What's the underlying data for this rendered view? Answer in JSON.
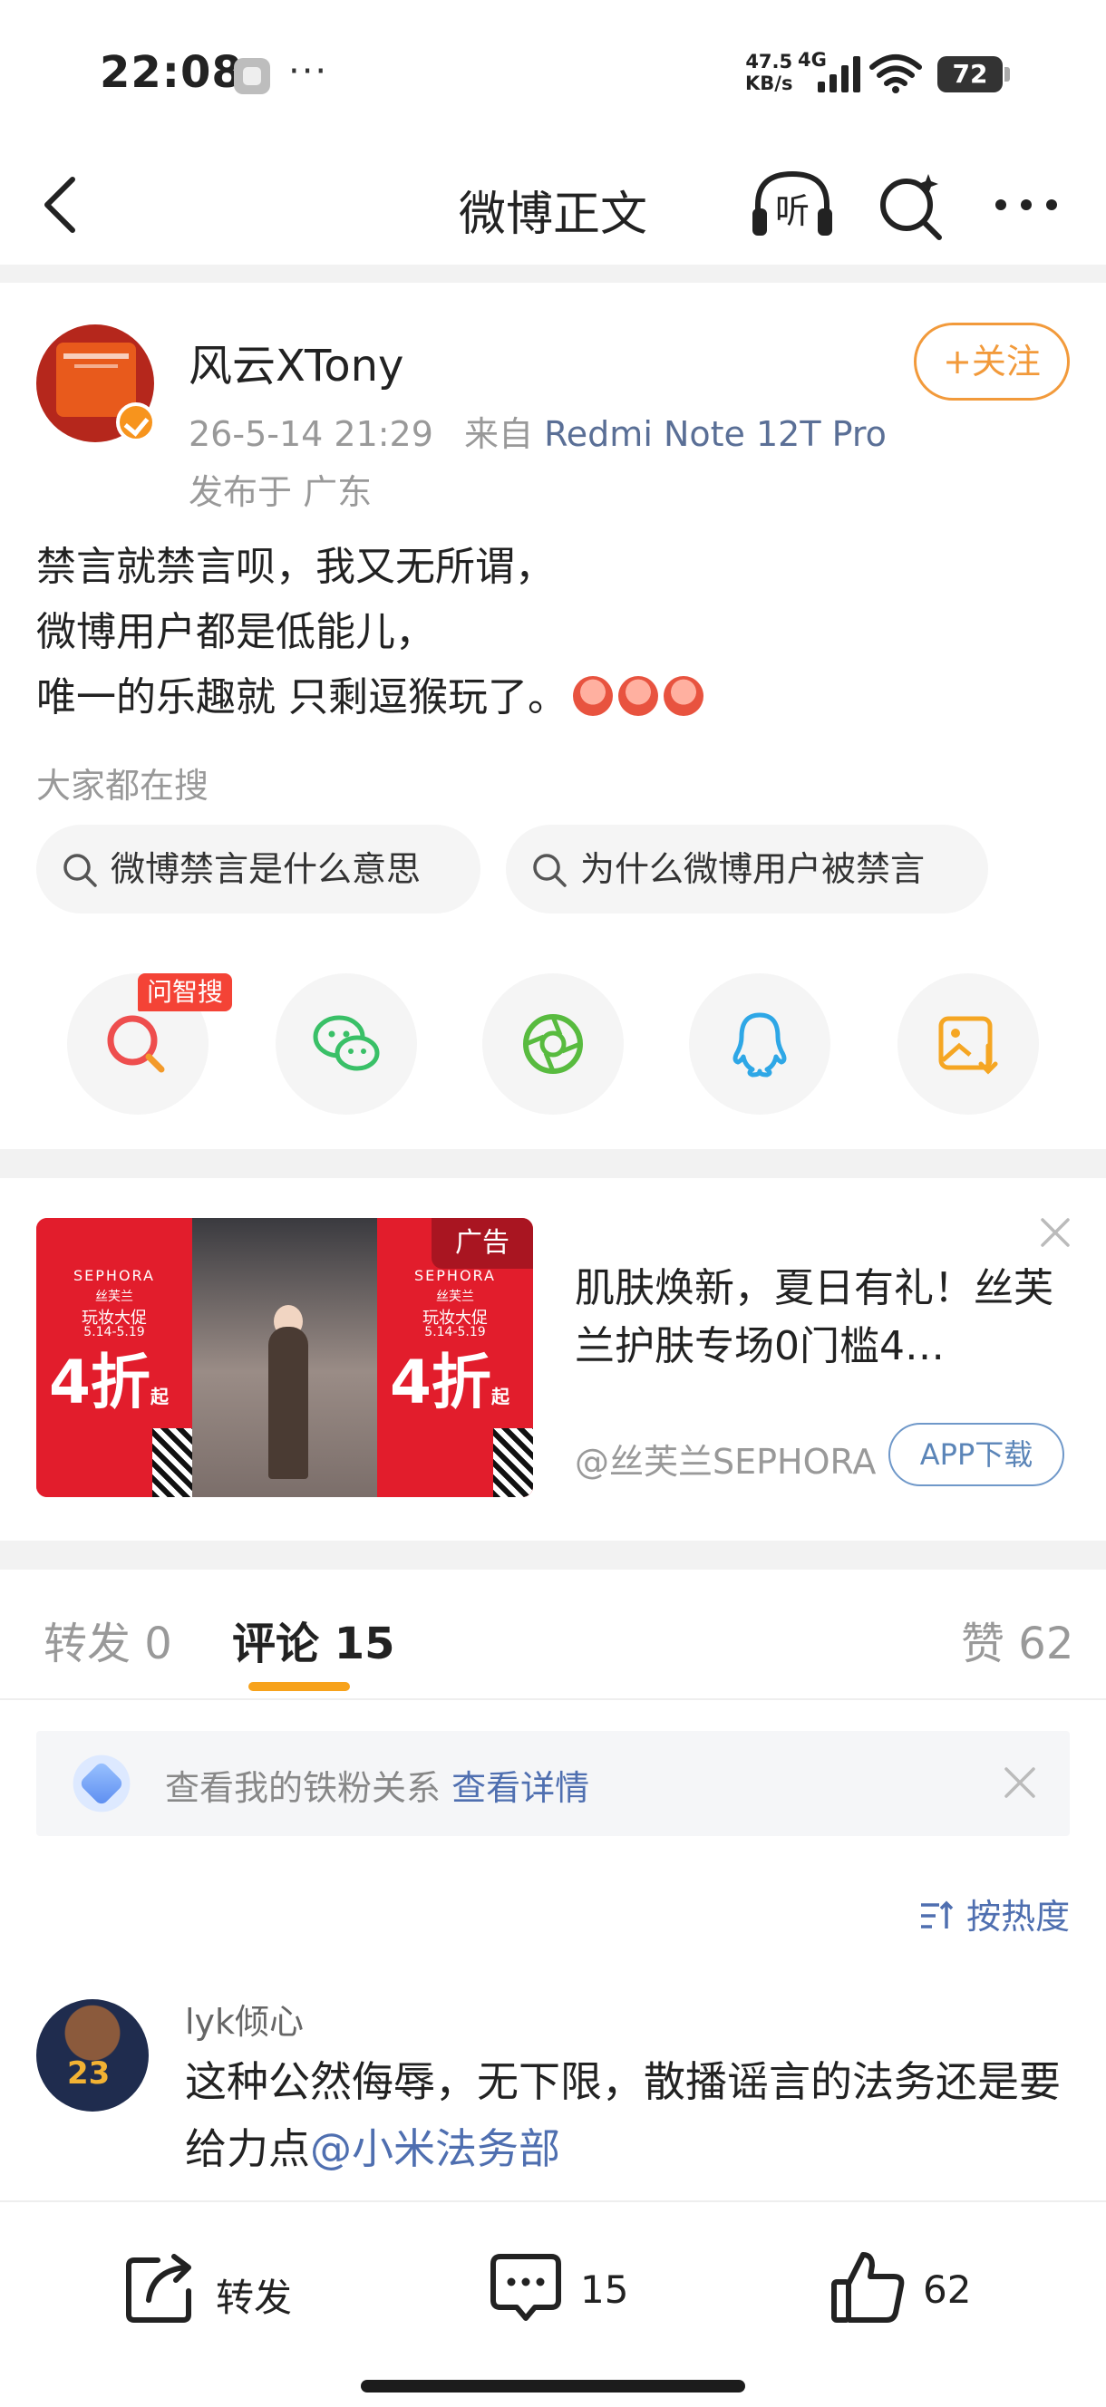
{
  "status_bar": {
    "time": "22:08",
    "more": "···",
    "speed_value": "47.5",
    "speed_unit": "KB/s",
    "network": "4G",
    "battery": "72",
    "icons": [
      "app-icon",
      "signal-icon",
      "wifi-icon",
      "battery-icon"
    ]
  },
  "nav": {
    "title": "微博正文",
    "listen_label": "听",
    "icons": [
      "back-icon",
      "listen-icon",
      "search-icon",
      "more-icon"
    ]
  },
  "post": {
    "author": "风云XTony",
    "timestamp": "26-5-14 21:29",
    "source_prefix": "来自",
    "source": "Redmi Note 12T Pro",
    "location": "发布于 广东",
    "follow_label": "+关注",
    "lines": [
      "禁言就禁言呗，我又无所谓，",
      "微博用户都是低能儿，",
      "唯一的乐趣就 只剩逗猴玩了。"
    ],
    "emoji": [
      "laugh-emoji",
      "laugh-emoji",
      "laugh-emoji"
    ]
  },
  "hot_search": {
    "label": "大家都在搜",
    "tags": [
      "微博禁言是什么意思",
      "为什么微博用户被禁言"
    ]
  },
  "share": {
    "badge": "问智搜",
    "items": [
      "wenzhisou-icon",
      "wechat-icon",
      "moments-icon",
      "qq-icon",
      "save-image-icon"
    ]
  },
  "ad": {
    "tag": "广告",
    "title": "肌肤焕新，夏日有礼！丝芙兰护肤专场0门槛4…",
    "account": "@丝芙兰SEPHORA",
    "button": "APP下载",
    "image_brand": "SEPHORA",
    "image_brand_cn": "丝芙兰",
    "image_event": "玩妆大促",
    "image_dates": "5.14-5.19",
    "image_discount": "4折",
    "image_discount_suffix": "起"
  },
  "tabs": {
    "repost_label": "转发",
    "repost_count": "0",
    "comment_label": "评论",
    "comment_count": "15",
    "like_label": "赞",
    "like_count": "62"
  },
  "fan_notice": {
    "text": "查看我的铁粉关系",
    "link": "查看详情"
  },
  "sort_label": "按热度",
  "comment": {
    "user": "lyk倾心",
    "text": "这种公然侮辱，无下限，散播谣言的法务还是要给力点",
    "mention": "@小米法务部"
  },
  "bottom_bar": {
    "repost_label": "转发",
    "comment_count": "15",
    "like_count": "62"
  },
  "colors": {
    "accent_orange": "#f29a3b",
    "link_blue": "#4f6fb0",
    "tab_underline": "#f7a21b",
    "gray_text": "#999999"
  }
}
